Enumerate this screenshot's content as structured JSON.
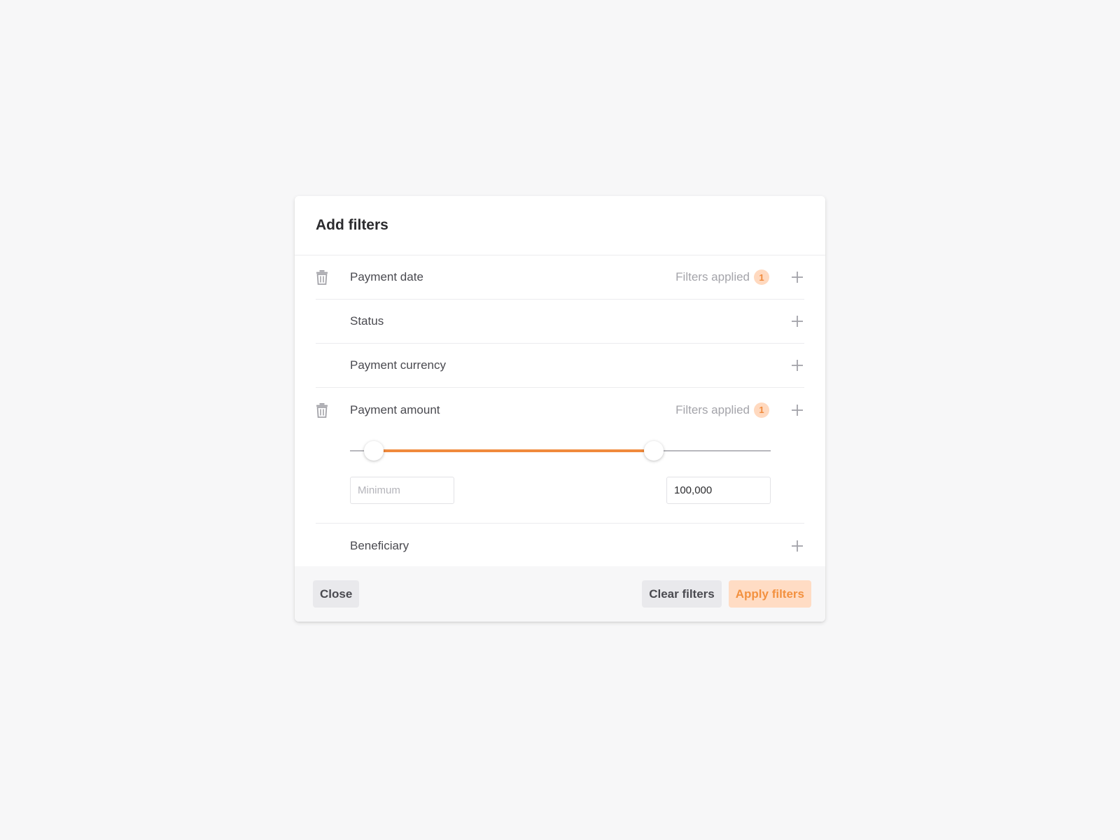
{
  "modal": {
    "title": "Add filters"
  },
  "filters": [
    {
      "label": "Payment date",
      "applied_text": "Filters applied",
      "applied_count": "1"
    },
    {
      "label": "Status"
    },
    {
      "label": "Payment currency"
    },
    {
      "label": "Payment amount",
      "applied_text": "Filters applied",
      "applied_count": "1"
    },
    {
      "label": "Beneficiary"
    }
  ],
  "amount_range": {
    "min_placeholder": "Minimum",
    "min_value": "",
    "max_value": "100,000",
    "selected_low_fraction": 0.056,
    "selected_high_fraction": 0.722
  },
  "footer": {
    "close_label": "Close",
    "clear_label": "Clear filters",
    "apply_label": "Apply filters"
  },
  "colors": {
    "accent": "#f08a3c",
    "accent_light": "#ffdcc4",
    "page_background": "#f7f7f8"
  },
  "icons": {
    "remove": "trash-icon",
    "expand": "plus-icon"
  }
}
